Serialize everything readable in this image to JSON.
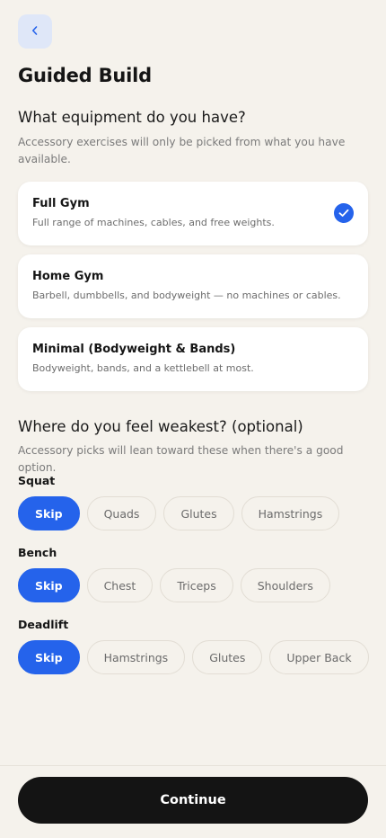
{
  "header": {
    "title": "Guided Build"
  },
  "equipment": {
    "title": "What equipment do you have?",
    "subtitle": "Accessory exercises will only be picked from what you have available.",
    "options": [
      {
        "title": "Full Gym",
        "desc": "Full range of machines, cables, and free weights.",
        "selected": true
      },
      {
        "title": "Home Gym",
        "desc": "Barbell, dumbbells, and bodyweight — no machines or cables.",
        "selected": false
      },
      {
        "title": "Minimal (Bodyweight & Bands)",
        "desc": "Bodyweight, bands, and a kettlebell at most.",
        "selected": false
      }
    ]
  },
  "weakness": {
    "title": "Where do you feel weakest? (optional)",
    "subtitle": "Accessory picks will lean toward these when there's a good option.",
    "groups": [
      {
        "label": "Squat",
        "chips": [
          "Skip",
          "Quads",
          "Glutes",
          "Hamstrings"
        ],
        "selected": "Skip"
      },
      {
        "label": "Bench",
        "chips": [
          "Skip",
          "Chest",
          "Triceps",
          "Shoulders"
        ],
        "selected": "Skip"
      },
      {
        "label": "Deadlift",
        "chips": [
          "Skip",
          "Hamstrings",
          "Glutes",
          "Upper Back"
        ],
        "selected": "Skip"
      }
    ]
  },
  "footer": {
    "continue_label": "Continue"
  },
  "colors": {
    "accent": "#2563eb",
    "background": "#f5f2ec",
    "button": "#141414"
  },
  "icons": {
    "back": "chevron-left-icon",
    "check": "check-icon"
  }
}
